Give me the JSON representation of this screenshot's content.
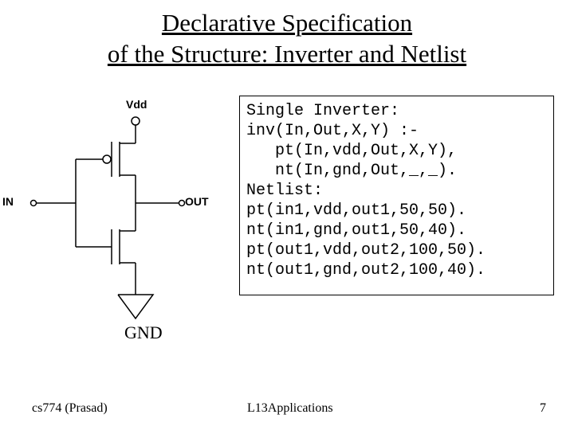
{
  "title_line1": "Declarative Specification",
  "title_line2": "of the Structure: Inverter and Netlist",
  "diagram": {
    "vdd": "Vdd",
    "in": "IN",
    "out": "OUT",
    "gnd": "GND"
  },
  "code": {
    "l1": "Single Inverter:",
    "l2": "inv(In,Out,X,Y) :-",
    "l3": "   pt(In,vdd,Out,X,Y),",
    "l4": "   nt(In,gnd,Out,_,_).",
    "l5": "Netlist:",
    "l6": "pt(in1,vdd,out1,50,50).",
    "l7": "nt(in1,gnd,out1,50,40).",
    "l8": "pt(out1,vdd,out2,100,50).",
    "l9": "nt(out1,gnd,out2,100,40)."
  },
  "footer": {
    "left": "cs774 (Prasad)",
    "center": "L13Applications",
    "right": "7"
  }
}
